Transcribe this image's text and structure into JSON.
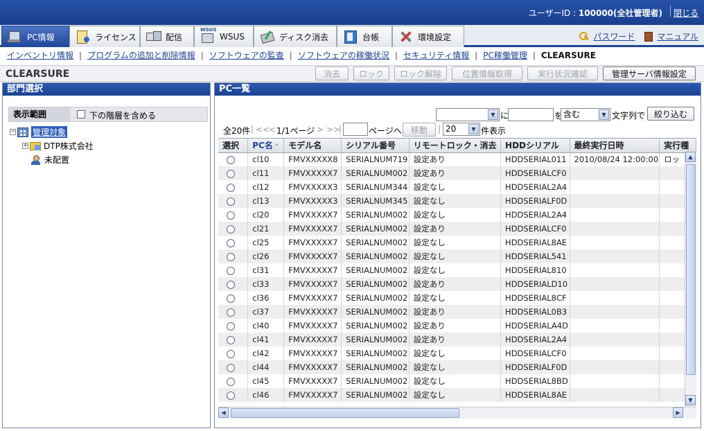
{
  "header": {
    "user_label": "ユーザーID : ",
    "user_value": "100000(全社管理者)",
    "logout": "閉じる"
  },
  "tabs": [
    {
      "label": "PC情報",
      "icon": "pc-icon",
      "active": true
    },
    {
      "label": "ライセンス",
      "icon": "license-icon"
    },
    {
      "label": "配信",
      "icon": "distribution-icon"
    },
    {
      "label": "WSUS",
      "icon": "wsus-icon"
    },
    {
      "label": "ディスク消去",
      "icon": "disk-erase-icon"
    },
    {
      "label": "台帳",
      "icon": "ledger-icon"
    },
    {
      "label": "環境設定",
      "icon": "settings-tools-icon"
    }
  ],
  "top_links": {
    "password": "パスワード",
    "manual": "マニュアル"
  },
  "subnav": [
    "インベントリ情報",
    "プログラムの追加と削除情報",
    "ソフトウェアの監査",
    "ソフトウェアの稼働状況",
    "セキュリティ情報",
    "PC稼働管理",
    "CLEARSURE"
  ],
  "page_title": "CLEARSURE",
  "toolbar": {
    "erase": "消去",
    "lock": "ロック",
    "unlock": "ロック解除",
    "location": "位置情報取得",
    "status": "実行状況確認",
    "server": "管理サーバ情報設定"
  },
  "dept_panel": {
    "title": "部門選択",
    "scope_label": "表示範囲",
    "include_sub": "下の階層を含める",
    "tree": [
      "管理対象",
      "DTP株式会社",
      "未配置"
    ]
  },
  "pc_panel": {
    "title": "PC一覧",
    "filter": {
      "ni": "に",
      "wo": "を",
      "match": "含む",
      "suffix": "文字列で",
      "apply": "絞り込む"
    },
    "paging": {
      "total": "全20件",
      "first": "<<",
      "prev": "<",
      "page": "1/1ページ",
      "next": ">",
      "last": ">>",
      "to_page": "ページへ",
      "move": "移動",
      "per_page": "20",
      "per_page_suffix": "件表示"
    },
    "columns": [
      "選択",
      "PC名",
      "モデル名",
      "シリアル番号",
      "リモートロック・消去",
      "HDDシリアル",
      "最終実行日時",
      "実行種"
    ],
    "rows": [
      {
        "pc": "cl10",
        "model": "FMVXXXXX8",
        "serial": "SERIALNUM719",
        "lock": "設定あり",
        "hdd": "HDDSERIAL011",
        "last": "2010/08/24 12:00:00",
        "type": "ロッ"
      },
      {
        "pc": "cl11",
        "model": "FMVXXXXX7",
        "serial": "SERIALNUM002",
        "lock": "設定あり",
        "hdd": "HDDSERIALCF0",
        "last": "",
        "type": ""
      },
      {
        "pc": "cl12",
        "model": "FMVXXXXX3",
        "serial": "SERIALNUM344",
        "lock": "設定なし",
        "hdd": "HDDSERIAL2A4",
        "last": "",
        "type": ""
      },
      {
        "pc": "cl13",
        "model": "FMVXXXXX3",
        "serial": "SERIALNUM345",
        "lock": "設定なし",
        "hdd": "HDDSERIALF0D",
        "last": "",
        "type": ""
      },
      {
        "pc": "cl20",
        "model": "FMVXXXXX7",
        "serial": "SERIALNUM002",
        "lock": "設定なし",
        "hdd": "HDDSERIAL2A4",
        "last": "",
        "type": ""
      },
      {
        "pc": "cl21",
        "model": "FMVXXXXX7",
        "serial": "SERIALNUM002",
        "lock": "設定あり",
        "hdd": "HDDSERIALCF0",
        "last": "",
        "type": ""
      },
      {
        "pc": "cl25",
        "model": "FMVXXXXX7",
        "serial": "SERIALNUM002",
        "lock": "設定なし",
        "hdd": "HDDSERIAL8AE",
        "last": "",
        "type": ""
      },
      {
        "pc": "cl26",
        "model": "FMVXXXXX7",
        "serial": "SERIALNUM002",
        "lock": "設定なし",
        "hdd": "HDDSERIAL541",
        "last": "",
        "type": ""
      },
      {
        "pc": "cl31",
        "model": "FMVXXXXX7",
        "serial": "SERIALNUM002",
        "lock": "設定なし",
        "hdd": "HDDSERIAL810",
        "last": "",
        "type": ""
      },
      {
        "pc": "cl33",
        "model": "FMVXXXXX7",
        "serial": "SERIALNUM002",
        "lock": "設定あり",
        "hdd": "HDDSERIALD10",
        "last": "",
        "type": ""
      },
      {
        "pc": "cl36",
        "model": "FMVXXXXX7",
        "serial": "SERIALNUM002",
        "lock": "設定なし",
        "hdd": "HDDSERIAL8CF",
        "last": "",
        "type": ""
      },
      {
        "pc": "cl37",
        "model": "FMVXXXXX7",
        "serial": "SERIALNUM002",
        "lock": "設定あり",
        "hdd": "HDDSERIAL0B3",
        "last": "",
        "type": ""
      },
      {
        "pc": "cl40",
        "model": "FMVXXXXX7",
        "serial": "SERIALNUM002",
        "lock": "設定あり",
        "hdd": "HDDSERIALA4D",
        "last": "",
        "type": ""
      },
      {
        "pc": "cl41",
        "model": "FMVXXXXX7",
        "serial": "SERIALNUM002",
        "lock": "設定あり",
        "hdd": "HDDSERIAL2A4",
        "last": "",
        "type": ""
      },
      {
        "pc": "cl42",
        "model": "FMVXXXXX7",
        "serial": "SERIALNUM002",
        "lock": "設定なし",
        "hdd": "HDDSERIALCF0",
        "last": "",
        "type": ""
      },
      {
        "pc": "cl44",
        "model": "FMVXXXXX7",
        "serial": "SERIALNUM002",
        "lock": "設定なし",
        "hdd": "HDDSERIALF0D",
        "last": "",
        "type": ""
      },
      {
        "pc": "cl45",
        "model": "FMVXXXXX7",
        "serial": "SERIALNUM002",
        "lock": "設定なし",
        "hdd": "HDDSERIAL8BD",
        "last": "",
        "type": ""
      },
      {
        "pc": "cl46",
        "model": "FMVXXXXX7",
        "serial": "SERIALNUM002",
        "lock": "設定なし",
        "hdd": "HDDSERIAL8AE",
        "last": "",
        "type": ""
      }
    ]
  }
}
